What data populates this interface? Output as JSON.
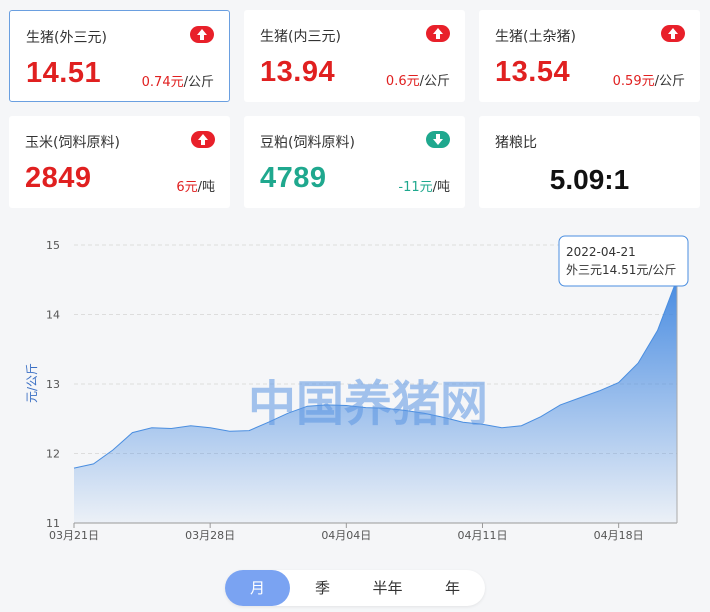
{
  "cards": [
    {
      "name": "生猪(外三元)",
      "price": "14.51",
      "change": "0.74元",
      "unit": "/公斤",
      "trend": "up",
      "trend_icon": "up-arrow-icon",
      "color": "#e02020",
      "active": true
    },
    {
      "name": "生猪(内三元)",
      "price": "13.94",
      "change": "0.6元",
      "unit": "/公斤",
      "trend": "up",
      "trend_icon": "up-arrow-icon",
      "color": "#e02020"
    },
    {
      "name": "生猪(土杂猪)",
      "price": "13.54",
      "change": "0.59元",
      "unit": "/公斤",
      "trend": "up",
      "trend_icon": "up-arrow-icon",
      "color": "#e02020"
    },
    {
      "name": "玉米(饲料原料)",
      "price": "2849",
      "change": "6元",
      "unit": "/吨",
      "trend": "up",
      "trend_icon": "up-arrow-icon",
      "color": "#e02020"
    },
    {
      "name": "豆粕(饲料原料)",
      "price": "4789",
      "change": "-11元",
      "unit": "/吨",
      "trend": "down",
      "trend_icon": "down-arrow-icon",
      "color": "#1fa88e"
    },
    {
      "name": "猪粮比",
      "ratio": "5.09:1"
    }
  ],
  "chart_data": {
    "type": "area",
    "ylabel": "元/公斤",
    "ylim": [
      11,
      15
    ],
    "yticks": [
      "11",
      "12",
      "13",
      "14",
      "15"
    ],
    "xtick_labels": [
      "03月21日",
      "03月28日",
      "04月04日",
      "04月11日",
      "04月18日"
    ],
    "xtick_dates": [
      "2022-03-21",
      "2022-03-28",
      "2022-04-04",
      "2022-04-11",
      "2022-04-18"
    ],
    "grid": true,
    "color": "#4a8ee0",
    "watermark": "中国养猪网",
    "series": [
      {
        "name": "外三元",
        "x": [
          "2022-03-21",
          "2022-03-22",
          "2022-03-23",
          "2022-03-24",
          "2022-03-25",
          "2022-03-26",
          "2022-03-27",
          "2022-03-28",
          "2022-03-29",
          "2022-03-30",
          "2022-03-31",
          "2022-04-01",
          "2022-04-02",
          "2022-04-03",
          "2022-04-04",
          "2022-04-05",
          "2022-04-06",
          "2022-04-07",
          "2022-04-08",
          "2022-04-09",
          "2022-04-10",
          "2022-04-11",
          "2022-04-12",
          "2022-04-13",
          "2022-04-14",
          "2022-04-15",
          "2022-04-16",
          "2022-04-17",
          "2022-04-18",
          "2022-04-19",
          "2022-04-20",
          "2022-04-21"
        ],
        "y": [
          11.79,
          11.85,
          12.05,
          12.3,
          12.37,
          12.36,
          12.4,
          12.37,
          12.32,
          12.33,
          12.45,
          12.58,
          12.68,
          12.7,
          12.69,
          12.66,
          12.65,
          12.62,
          12.58,
          12.52,
          12.45,
          12.42,
          12.37,
          12.4,
          12.53,
          12.7,
          12.8,
          12.9,
          13.02,
          13.3,
          13.77,
          14.51
        ]
      }
    ],
    "tooltip": {
      "date": "2022-04-21",
      "label": "外三元14.51元/公斤"
    }
  },
  "period_tabs": {
    "items": [
      "月",
      "季",
      "半年",
      "年"
    ],
    "active": "月"
  }
}
